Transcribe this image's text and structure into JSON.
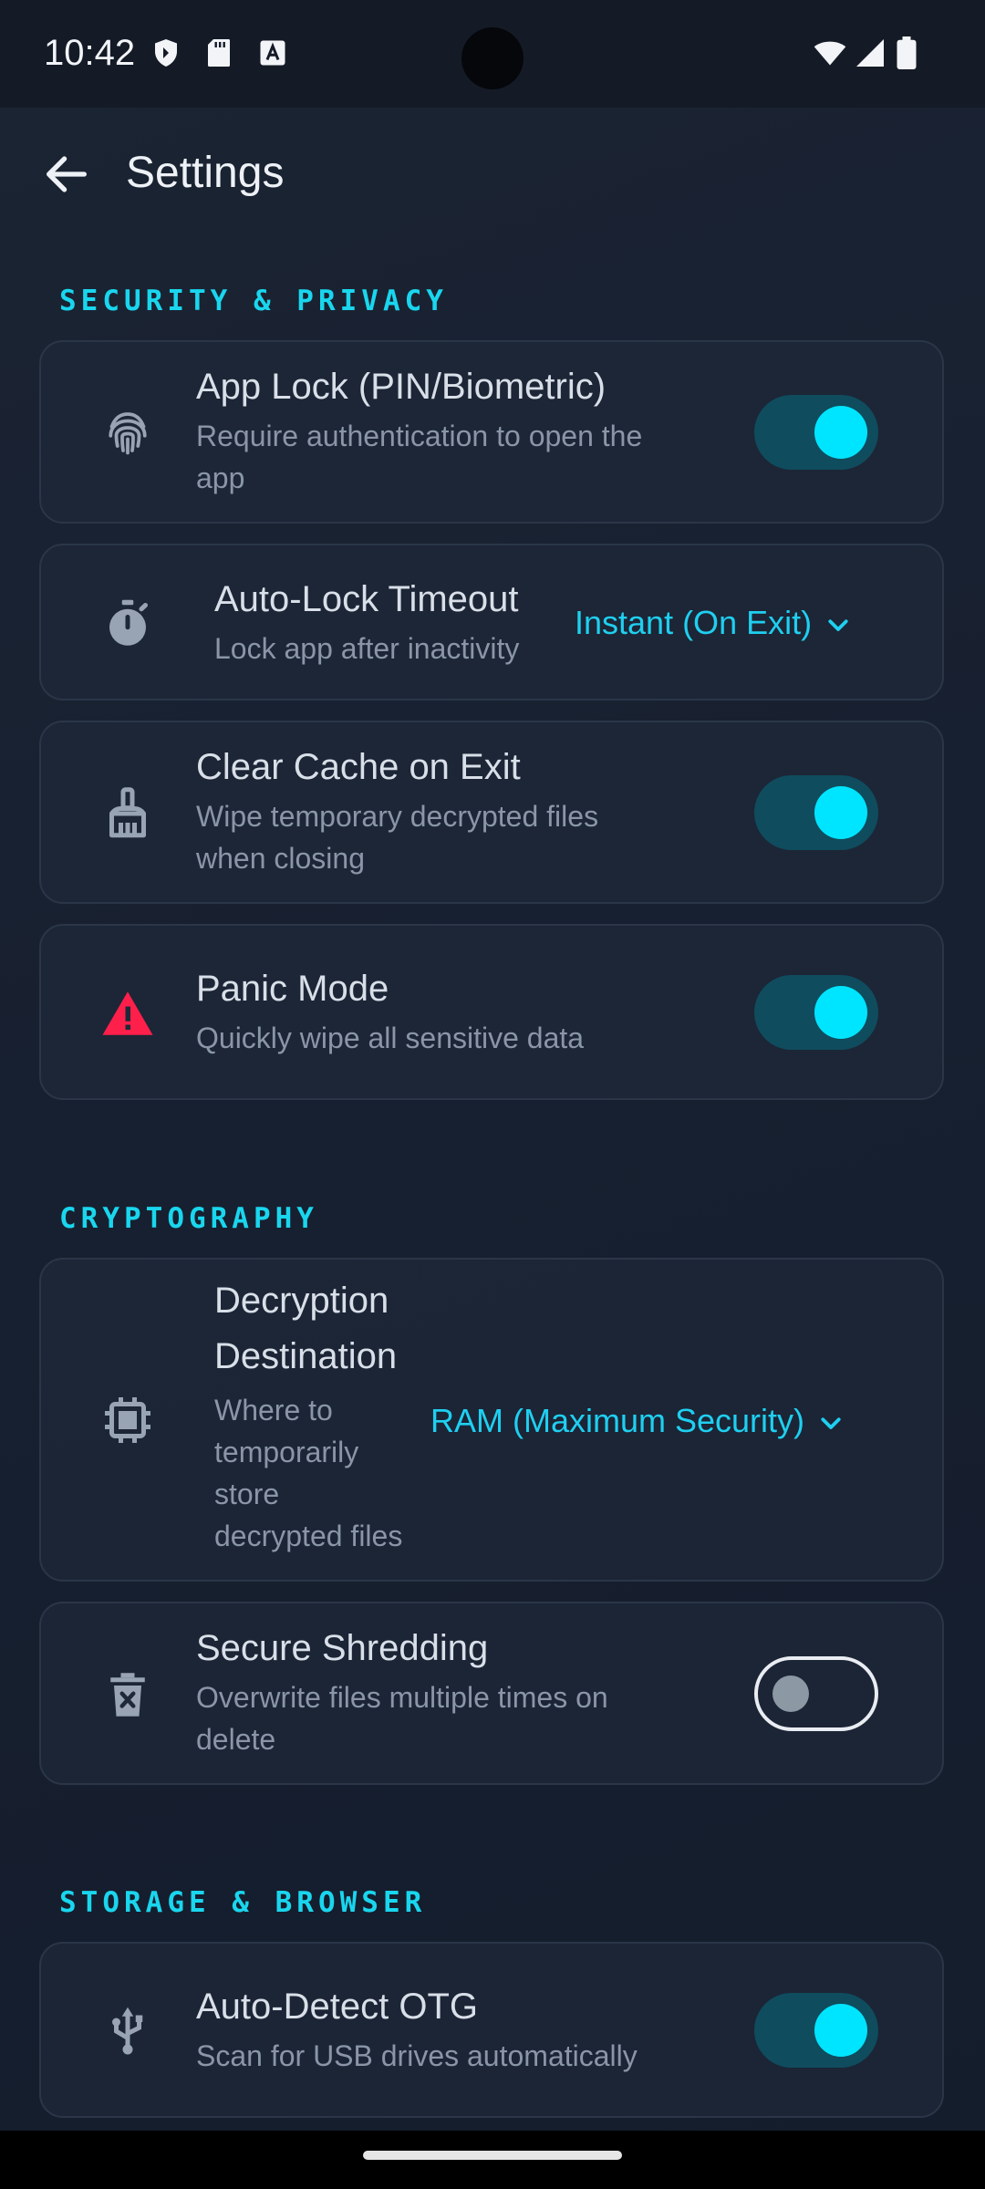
{
  "status_bar": {
    "time": "10:42"
  },
  "app_bar": {
    "title": "Settings"
  },
  "sections": {
    "security": "SECURITY & PRIVACY",
    "crypto": "CRYPTOGRAPHY",
    "storage": "STORAGE & BROWSER"
  },
  "settings": {
    "app_lock": {
      "title": "App Lock (PIN/Biometric)",
      "desc_line1": "Require authentication to open the",
      "desc_line2": "app",
      "enabled": true,
      "icon": "fingerprint-icon"
    },
    "auto_lock": {
      "title": "Auto-Lock Timeout",
      "desc": "Lock app after inactivity",
      "value": "Instant (On Exit)",
      "icon": "timer-icon"
    },
    "clear_cache": {
      "title": "Clear Cache on Exit",
      "desc_line1": "Wipe temporary decrypted files",
      "desc_line2": "when closing",
      "enabled": true,
      "icon": "broom-icon"
    },
    "panic_mode": {
      "title": "Panic Mode",
      "desc": "Quickly wipe all sensitive data",
      "enabled": true,
      "icon": "warning-icon"
    },
    "decryption_destination": {
      "title_line1": "Decryption",
      "title_line2": "Destination",
      "desc_line1": "Where to",
      "desc_line2": "temporarily",
      "desc_line3": "store",
      "desc_line4": "decrypted files",
      "value": "RAM (Maximum Security)",
      "icon": "chip-icon"
    },
    "secure_shredding": {
      "title": "Secure Shredding",
      "desc_line1": "Overwrite files multiple times on",
      "desc_line2": "delete",
      "enabled": false,
      "icon": "trash-x-icon"
    },
    "auto_detect_otg": {
      "title": "Auto-Detect OTG",
      "desc": "Scan for USB drives automatically",
      "enabled": true,
      "icon": "usb-icon"
    }
  },
  "colors": {
    "accent": "#00e5ff",
    "section": "#19d6ee",
    "warning": "#ff1f4b",
    "toggle_track": "#0f4c5e"
  }
}
